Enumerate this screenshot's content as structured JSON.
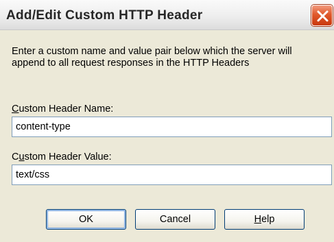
{
  "dialog": {
    "title": "Add/Edit Custom HTTP Header",
    "description": "Enter a custom name and value pair below which the server will append to all request responses in the HTTP Headers"
  },
  "fields": {
    "name": {
      "label_accel": "C",
      "label_rest": "ustom Header Name:",
      "value": "content-type"
    },
    "value": {
      "label_pre": "C",
      "label_accel": "u",
      "label_rest": "stom Header Value:",
      "value": "text/css"
    }
  },
  "buttons": {
    "ok_label": "OK",
    "cancel_label": "Cancel",
    "help_accel": "H",
    "help_rest": "elp"
  },
  "colors": {
    "close_button": "#d9511f",
    "input_border": "#7f9db9",
    "dialog_background": "#ece9d8"
  },
  "icons": {
    "close": "close-icon"
  }
}
